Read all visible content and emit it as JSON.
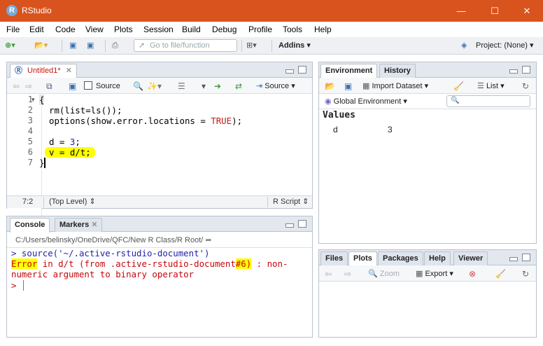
{
  "window": {
    "title": "RStudio",
    "icon": "R",
    "minimize": "—",
    "maximize": "☐",
    "close": "✕"
  },
  "menu": [
    "File",
    "Edit",
    "Code",
    "View",
    "Plots",
    "Session",
    "Build",
    "Debug",
    "Profile",
    "Tools",
    "Help"
  ],
  "toolbar": {
    "goto_placeholder": "Go to file/function",
    "addins": "Addins",
    "project": "Project: (None)"
  },
  "editor": {
    "tab": "Untitled1*",
    "source_on_save": "Source",
    "source_button": "Source",
    "lines": [
      "1",
      "2",
      "3",
      "4",
      "5",
      "6",
      "7"
    ],
    "code": {
      "l1": "{",
      "l2_fn": "rm(list=ls());",
      "l3_fn": "options(show.error.locations = ",
      "l3_kw": "TRUE",
      "l3_end": ");",
      "l5_a": "d = ",
      "l5_num": "3",
      "l5_end": ";",
      "l6": "v = d/t;",
      "l7": "}"
    },
    "status_pos": "7:2",
    "status_scope": "(Top Level)",
    "status_type": "R Script"
  },
  "console": {
    "tab_console": "Console",
    "tab_markers": "Markers",
    "path": "C:/Users/belinsky/OneDrive/QFC/New R Class/R Root/",
    "line1": "> source('~/.active-rstudio-document')",
    "err_word": "Error",
    "err_rest1": " in d/t (from .active-rstudio-document",
    "err_loc": "#6)",
    "err_rest2": " : non-",
    "err_line2": "numeric argument to binary operator",
    "prompt": "> "
  },
  "environment": {
    "tab_env": "Environment",
    "tab_history": "History",
    "import": "Import Dataset",
    "list": "List",
    "scope": "Global Environment",
    "section": "Values",
    "var_name": "d",
    "var_value": "3"
  },
  "files": {
    "tabs": [
      "Files",
      "Plots",
      "Packages",
      "Help",
      "Viewer"
    ],
    "zoom": "Zoom",
    "export": "Export"
  },
  "colors": {
    "titlebar": "#d9531e",
    "highlight": "#ffff00",
    "error": "#c5060b"
  }
}
